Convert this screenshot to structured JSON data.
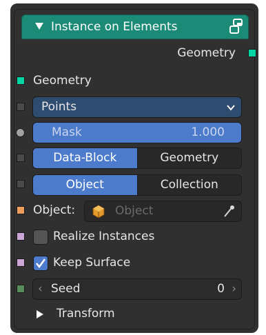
{
  "node": {
    "title": "Instance on Elements",
    "output_geometry": "Geometry",
    "input_geometry": "Geometry",
    "points_dropdown": "Points",
    "mask_label": "Mask",
    "mask_value": "1.000",
    "segment1": [
      "Data-Block",
      "Geometry"
    ],
    "segment2": [
      "Object",
      "Collection"
    ],
    "object_label": "Object:",
    "object_placeholder": "Object",
    "realize_label": "Realize Instances",
    "keep_label": "Keep Surface",
    "seed_label": "Seed",
    "seed_value": "0",
    "transform_label": "Transform",
    "realize_checked": false,
    "keep_checked": true
  },
  "colors": {
    "header": "#1b8a77",
    "geometry_socket": "#00d6a3",
    "object_socket": "#ed9e5c",
    "bool_socket": "#cca6d6",
    "int_socket": "#598c5c",
    "gray_socket": "#7a7a7a",
    "accent": "#4d7bcc"
  },
  "icons": {
    "header": "node-tree-icon",
    "object": "cube-icon",
    "eyedropper": "eyedropper-icon"
  }
}
